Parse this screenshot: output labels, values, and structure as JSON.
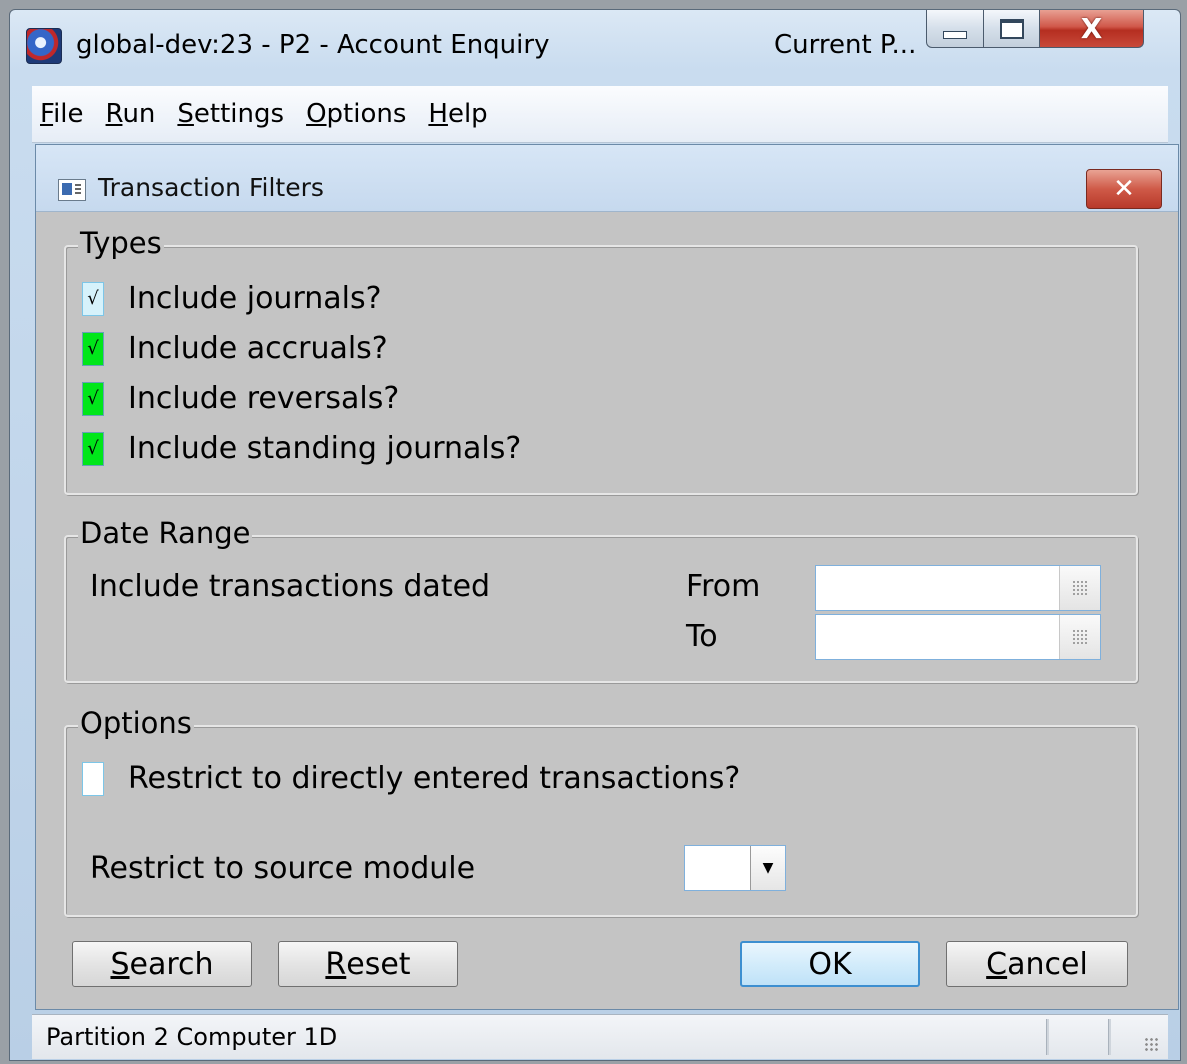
{
  "window": {
    "title": "global-dev:23 - P2 - Account Enquiry",
    "title_right": "Current P...",
    "close_glyph": "X"
  },
  "menu": [
    {
      "accel": "F",
      "rest": "ile"
    },
    {
      "accel": "R",
      "rest": "un"
    },
    {
      "accel": "S",
      "rest": "ettings"
    },
    {
      "accel": "O",
      "rest": "ptions"
    },
    {
      "accel": "H",
      "rest": "elp"
    }
  ],
  "dialog": {
    "title": "Transaction Filters",
    "close_glyph": "✕"
  },
  "types": {
    "legend": "Types",
    "items": [
      {
        "label": "Include journals?",
        "checked": true
      },
      {
        "label": "Include accruals?",
        "checked": true
      },
      {
        "label": "Include reversals?",
        "checked": true
      },
      {
        "label": "Include standing journals?",
        "checked": true
      }
    ],
    "check_glyph": "√"
  },
  "date_range": {
    "legend": "Date Range",
    "prompt": "Include transactions dated",
    "from_label": "From",
    "to_label": "To",
    "from_value": "",
    "to_value": ""
  },
  "options": {
    "legend": "Options",
    "restrict_direct_label": "Restrict to directly entered transactions?",
    "restrict_direct_checked": false,
    "source_module_label": "Restrict to source module",
    "source_module_value": "",
    "dropdown_glyph": "▼"
  },
  "buttons": {
    "search": {
      "accel": "S",
      "rest": "earch"
    },
    "reset": {
      "accel": "R",
      "rest": "eset"
    },
    "ok": "OK",
    "cancel": {
      "accel": "C",
      "rest": "ancel"
    }
  },
  "status": {
    "text": "Partition 2 Computer 1D"
  },
  "colors": {
    "checkbox_checked": "#00e61a",
    "checkbox_focused": "#d6f2fb",
    "dialog_bg": "#c4c4c4",
    "ok_border": "#3d8fd0"
  }
}
